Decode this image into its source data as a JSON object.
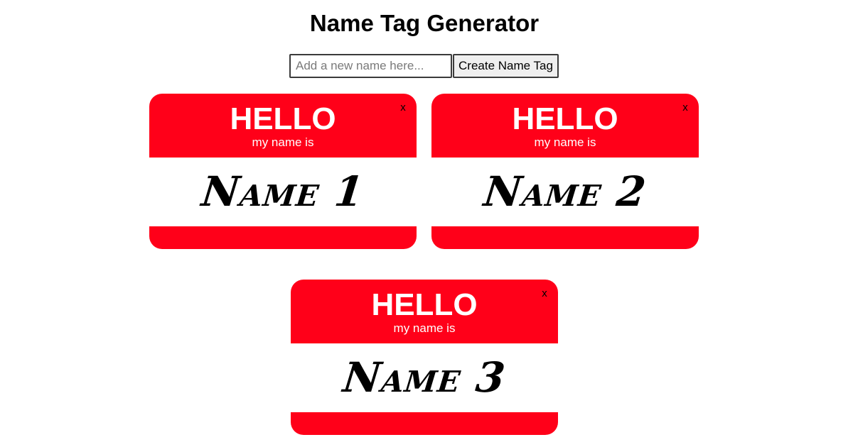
{
  "header": {
    "title": "Name Tag Generator"
  },
  "form": {
    "input_value": "",
    "input_placeholder": "Add a new name here...",
    "button_label": "Create Name Tag"
  },
  "tags": [
    {
      "hello": "HELLO",
      "subtitle": "my name is",
      "name": "Name 1",
      "close_label": "x"
    },
    {
      "hello": "HELLO",
      "subtitle": "my name is",
      "name": "Name 2",
      "close_label": "x"
    },
    {
      "hello": "HELLO",
      "subtitle": "my name is",
      "name": "Name 3",
      "close_label": "x"
    }
  ],
  "colors": {
    "tag_red": "#ff0019",
    "tag_body": "#ffffff",
    "text_dark": "#000000"
  }
}
